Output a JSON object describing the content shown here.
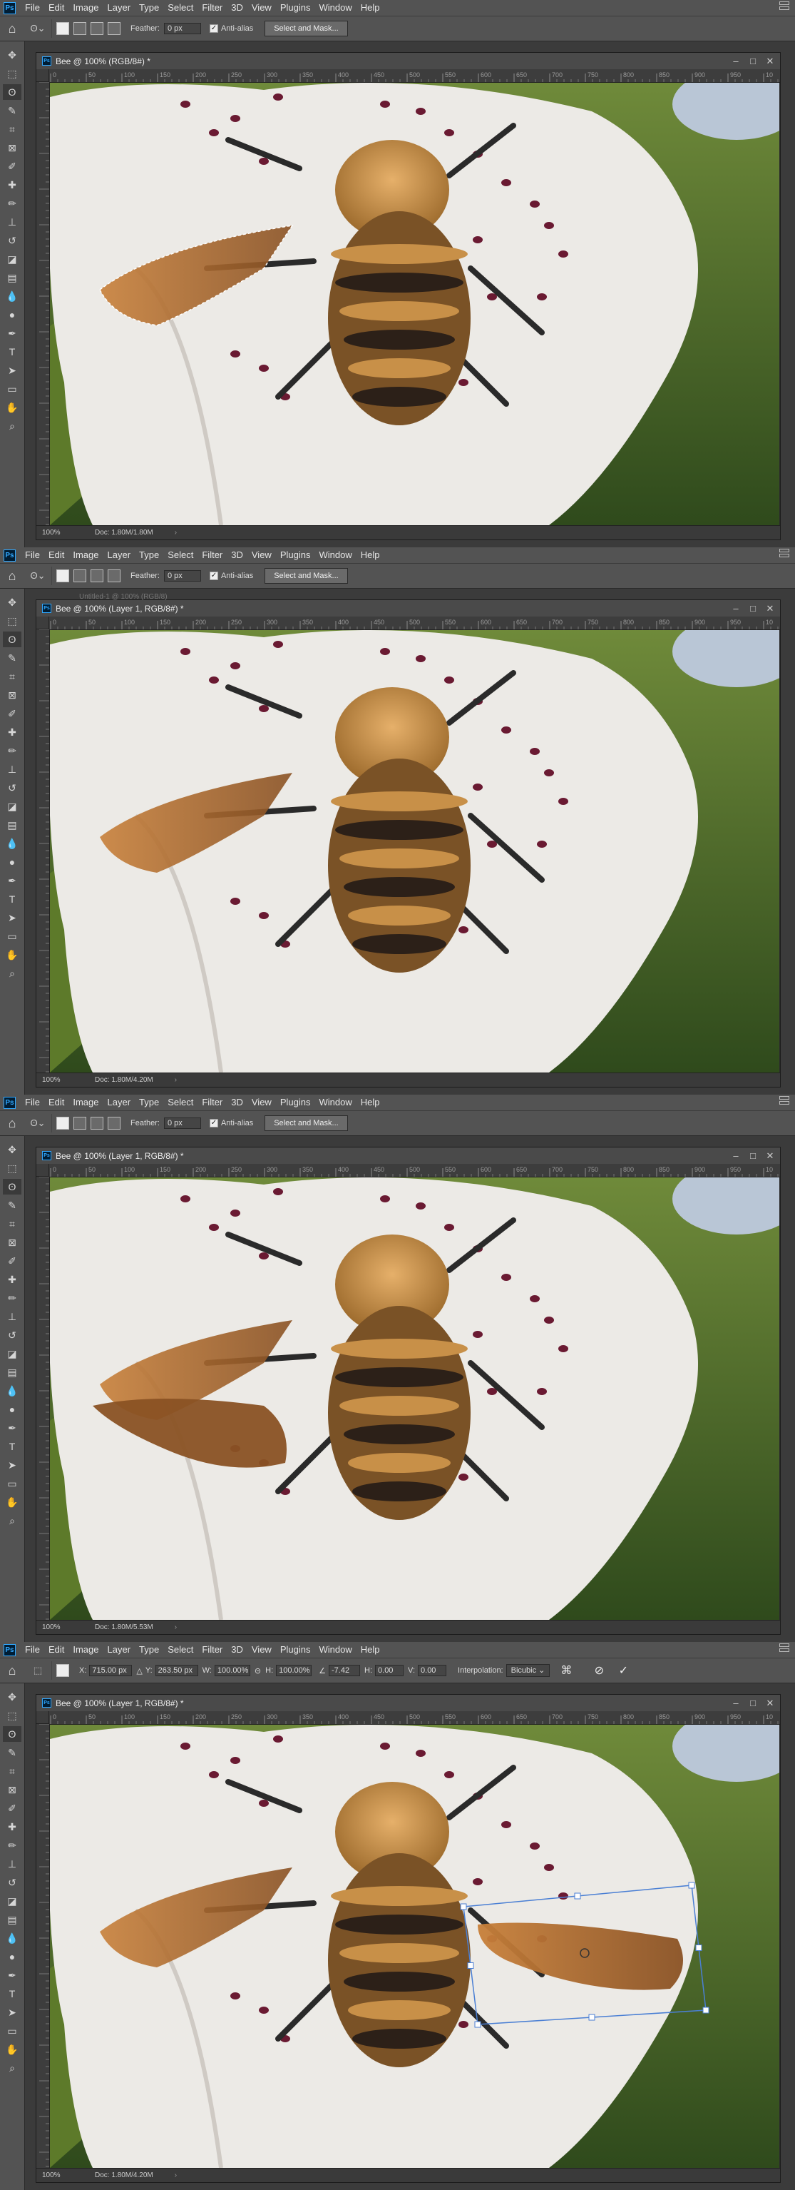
{
  "menu": {
    "logo": "Ps",
    "items": [
      "File",
      "Edit",
      "Image",
      "Layer",
      "Type",
      "Select",
      "Filter",
      "3D",
      "View",
      "Plugins",
      "Window",
      "Help"
    ]
  },
  "lasso_options": {
    "feather_label": "Feather:",
    "feather_value": "0 px",
    "antialias_label": "Anti-alias",
    "select_mask_label": "Select and Mask..."
  },
  "transform_options": {
    "x_label": "X:",
    "x_value": "715.00 px",
    "y_label": "Y:",
    "y_value": "263.50 px",
    "w_label": "W:",
    "w_value": "100.00%",
    "h_label": "H:",
    "h_value": "100.00%",
    "angle_value": "-7.42",
    "hskew_label": "H:",
    "hskew_value": "0.00",
    "vskew_label": "V:",
    "vskew_value": "0.00",
    "interpolation_label": "Interpolation:",
    "interpolation_value": "Bicubic"
  },
  "rulers": [
    "0",
    "50",
    "100",
    "150",
    "200",
    "250",
    "300",
    "350",
    "400",
    "450",
    "500",
    "550",
    "600",
    "650",
    "700",
    "750",
    "800",
    "850",
    "900",
    "950",
    "10"
  ],
  "panels": [
    {
      "doc_title": "Bee @ 100% (RGB/8#) *",
      "zoom": "100%",
      "doc_info": "Doc: 1.80M/1.80M",
      "mode": "lasso"
    },
    {
      "doc_title": "Bee @ 100% (Layer 1, RGB/8#) *",
      "ghost_title": "Untitled-1 @ 100% (RGB/8)",
      "zoom": "100%",
      "doc_info": "Doc: 1.80M/4.20M",
      "mode": "lasso"
    },
    {
      "doc_title": "Bee @ 100% (Layer 1, RGB/8#) *",
      "zoom": "100%",
      "doc_info": "Doc: 1.80M/5.53M",
      "mode": "lasso"
    },
    {
      "doc_title": "Bee @ 100% (Layer 1, RGB/8#) *",
      "zoom": "100%",
      "doc_info": "Doc: 1.80M/4.20M",
      "mode": "transform"
    }
  ],
  "tools": [
    "move-tool-icon",
    "marquee-tool-icon",
    "lasso-tool-icon",
    "quick-select-tool-icon",
    "crop-tool-icon",
    "frame-tool-icon",
    "eyedropper-tool-icon",
    "healing-tool-icon",
    "brush-tool-icon",
    "clone-stamp-tool-icon",
    "history-brush-tool-icon",
    "eraser-tool-icon",
    "gradient-tool-icon",
    "blur-tool-icon",
    "dodge-tool-icon",
    "pen-tool-icon",
    "type-tool-icon",
    "path-select-tool-icon",
    "shape-tool-icon",
    "hand-tool-icon",
    "zoom-tool-icon"
  ],
  "colors": {
    "ui_bg": "#535353",
    "canvas_bg": "#2b2b2b",
    "petal": "#eceae6",
    "leaf": "#4f6b2c",
    "bee_fur": "#d09a48",
    "wing": "#b8722e",
    "transform_box": "#4a7fd4"
  }
}
